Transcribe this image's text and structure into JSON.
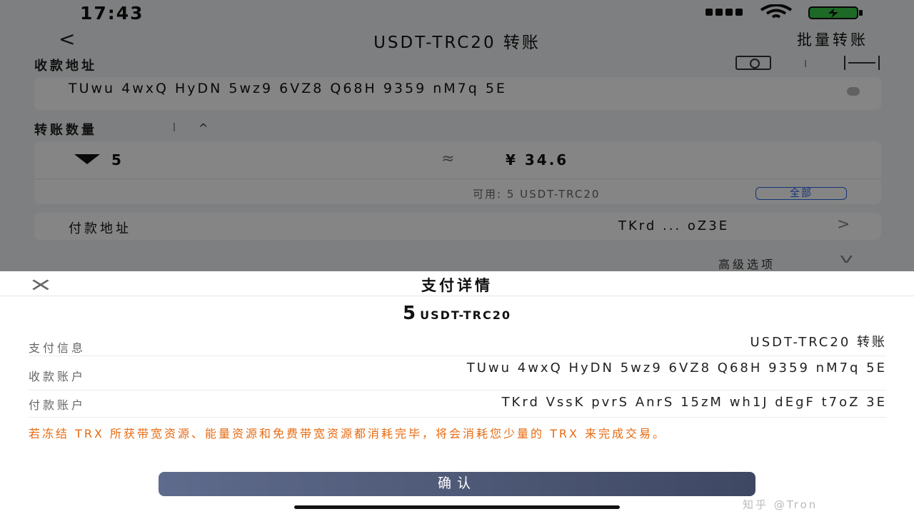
{
  "status_bar": {
    "time": "17:43"
  },
  "nav": {
    "title": "USDT-TRC20 转账",
    "batch": "批量转账"
  },
  "recipient": {
    "label": "收款地址",
    "address": "TUwu 4wxQ HyDN 5wz9 6VZ8 Q68H 9359 nM7q 5E"
  },
  "amount": {
    "label": "转账数量",
    "value": "5",
    "fiat": "¥ 34.6",
    "available": "可用: 5 USDT-TRC20",
    "all_button": "全部"
  },
  "payer": {
    "label": "付款地址",
    "value": "TKrd ... oZ3E"
  },
  "advanced": "高级选项",
  "sheet": {
    "title": "支付详情",
    "amount": "5",
    "currency": "USDT-TRC20",
    "rows": [
      {
        "label": "支付信息",
        "value": "USDT-TRC20 转账"
      },
      {
        "label": "收款账户",
        "value": "TUwu 4wxQ HyDN 5wz9 6VZ8 Q68H 9359 nM7q 5E"
      },
      {
        "label": "付款账户",
        "value": "TKrd VssK pvrS AnrS 15zM wh1J dEgF t7oZ 3E"
      }
    ],
    "warning": "若冻结 TRX 所获带宽资源、能量资源和免费带宽资源都消耗完毕，将会消耗您少量的 TRX 来完成交易。",
    "confirm": "确认"
  },
  "watermark": "知乎 @Tron",
  "colors": {
    "accent": "#2a68e6",
    "warning": "#e86a10",
    "button": "#4a5574"
  }
}
